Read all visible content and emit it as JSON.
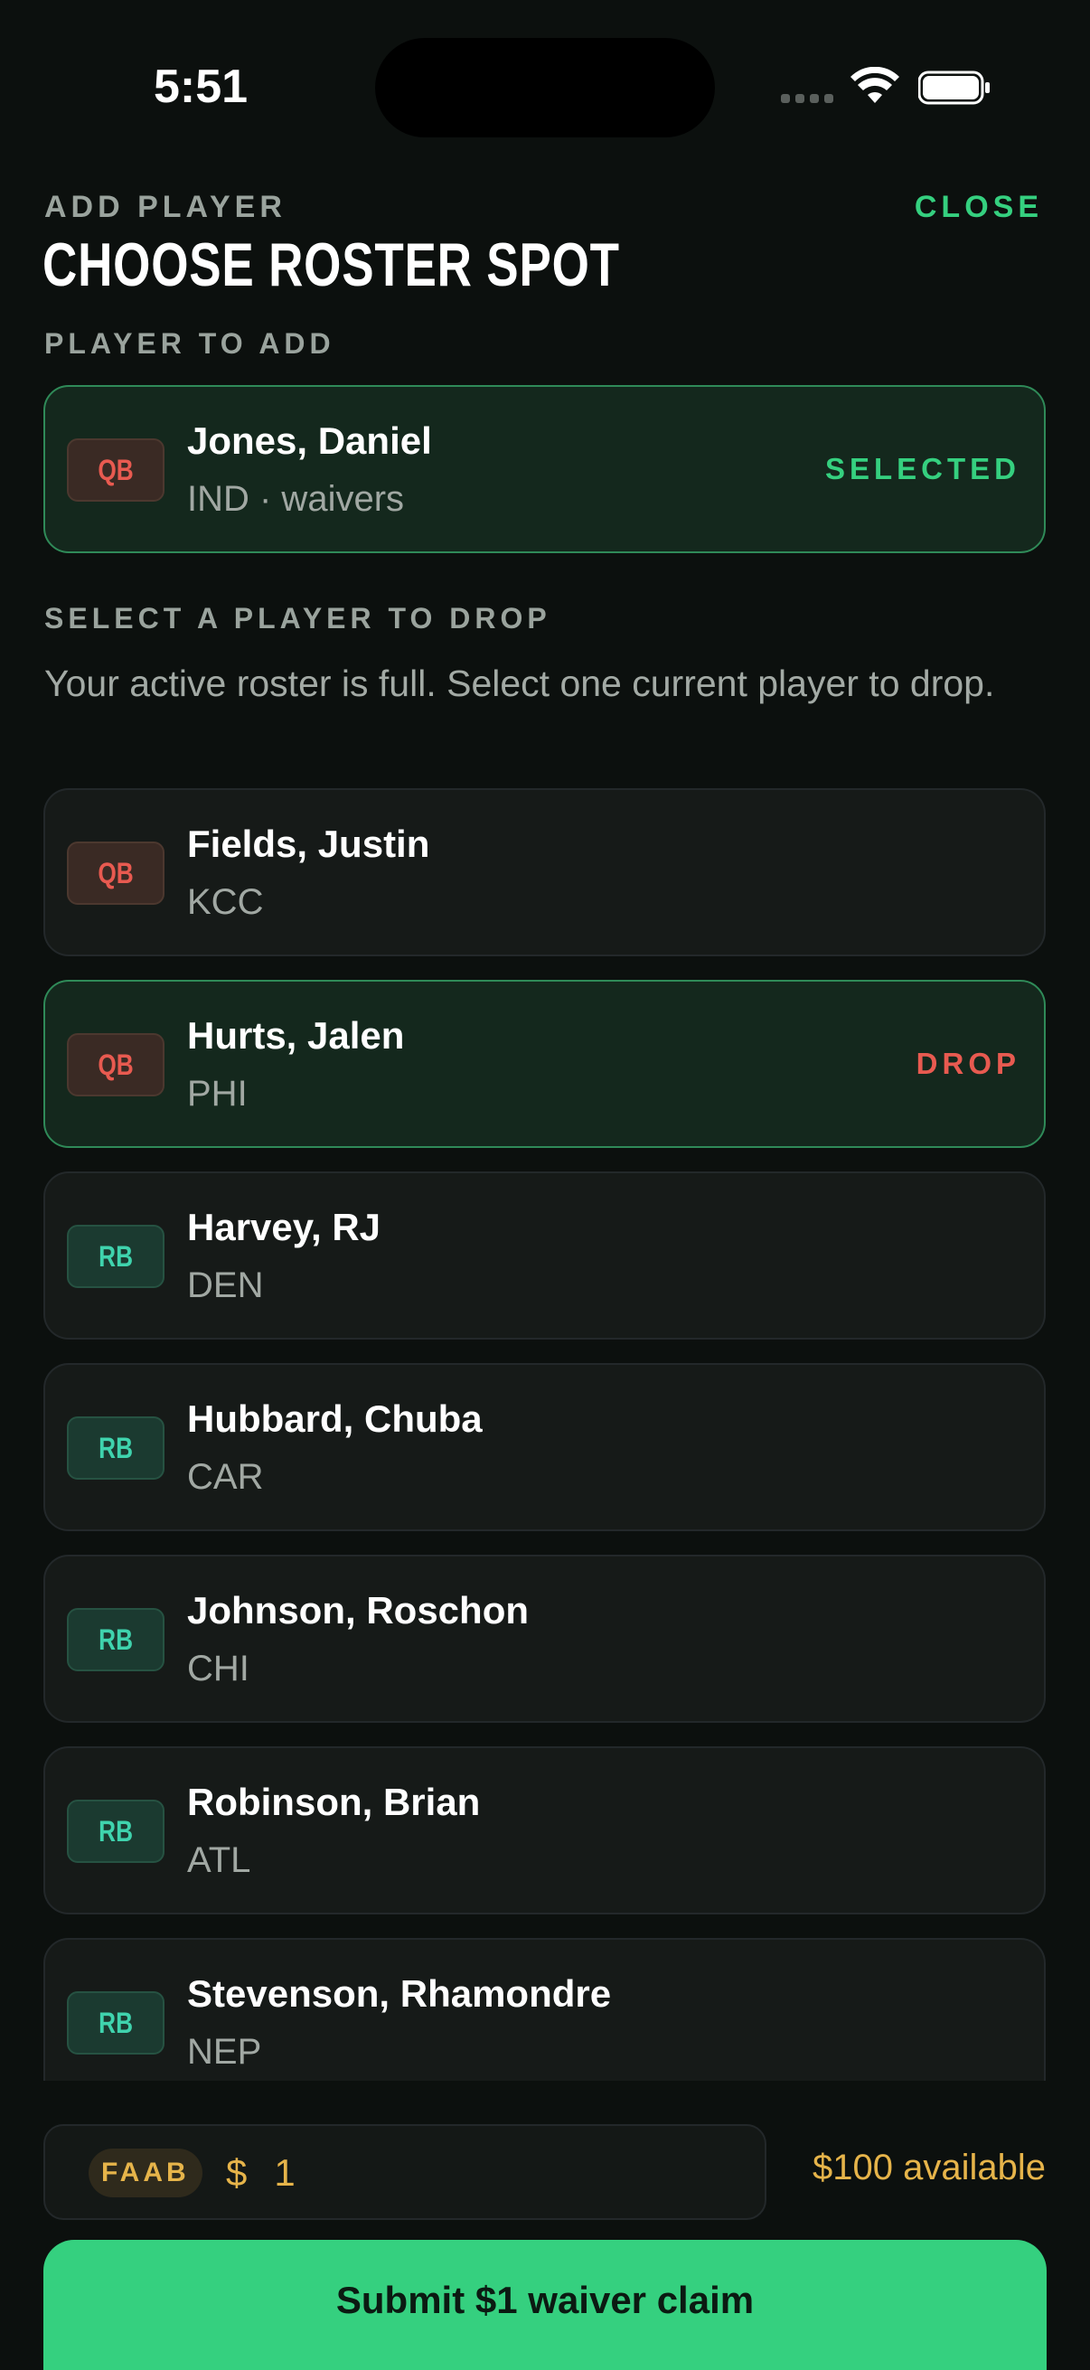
{
  "status_bar": {
    "time": "5:51"
  },
  "header": {
    "eyebrow": "ADD PLAYER",
    "title": "CHOOSE ROSTER SPOT",
    "close_label": "CLOSE"
  },
  "add_section": {
    "label": "PLAYER TO ADD",
    "player": {
      "position": "QB",
      "name": "Jones, Daniel",
      "detail": "IND · waivers",
      "tag": "SELECTED"
    }
  },
  "drop_section": {
    "label": "SELECT A PLAYER TO DROP",
    "help": "Your active roster is full. Select one current player to drop.",
    "players": [
      {
        "position": "QB",
        "name": "Fields, Justin",
        "team": "KCC",
        "tag": ""
      },
      {
        "position": "QB",
        "name": "Hurts, Jalen",
        "team": "PHI",
        "tag": "DROP"
      },
      {
        "position": "RB",
        "name": "Harvey, RJ",
        "team": "DEN",
        "tag": ""
      },
      {
        "position": "RB",
        "name": "Hubbard, Chuba",
        "team": "CAR",
        "tag": ""
      },
      {
        "position": "RB",
        "name": "Johnson, Roschon",
        "team": "CHI",
        "tag": ""
      },
      {
        "position": "RB",
        "name": "Robinson, Brian",
        "team": "ATL",
        "tag": ""
      },
      {
        "position": "RB",
        "name": "Stevenson, Rhamondre",
        "team": "NEP",
        "tag": ""
      }
    ]
  },
  "footer": {
    "faab_label": "FAAB",
    "currency": "$",
    "bid_value": "1",
    "available": "$100 available",
    "submit_label": "Submit $1 waiver claim"
  },
  "colors": {
    "background": "#0c100e",
    "accent_green": "#35d07f",
    "drop_red": "#e85a50",
    "faab_gold": "#e6b44a",
    "qb_badge": "#e85a50",
    "rb_badge": "#3fd3ad"
  }
}
